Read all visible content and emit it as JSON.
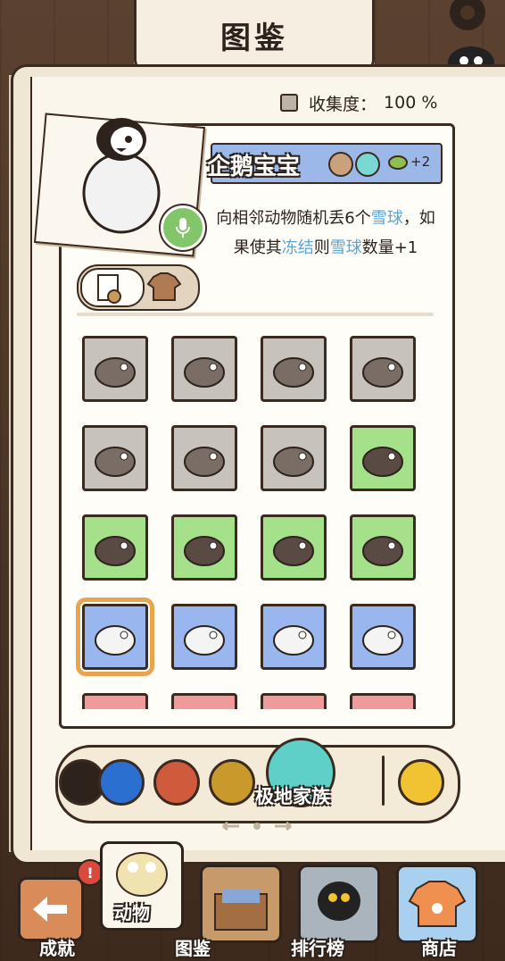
{
  "header": {
    "title": "图鉴"
  },
  "collection": {
    "label": "收集度：",
    "value": "100 %"
  },
  "animal": {
    "name": "企鹅宝宝",
    "cost_text": "+2",
    "desc_parts": [
      "向相邻动物随机丢6个",
      "雪球",
      "，如果使其",
      "冻结",
      "则",
      "雪球",
      "数量+1"
    ]
  },
  "family": {
    "selected_label": "极地家族"
  },
  "nav": {
    "achievements": "成就",
    "atlas": "图鉴",
    "animals": "动物",
    "ranking": "排行榜",
    "shop": "商店",
    "badge": "!"
  },
  "tiles": [
    {
      "name": "walrus-brown",
      "color": "gray"
    },
    {
      "name": "swallow",
      "color": "gray"
    },
    {
      "name": "puffin-dark",
      "color": "gray"
    },
    {
      "name": "otter",
      "color": "gray"
    },
    {
      "name": "walrus",
      "color": "gray"
    },
    {
      "name": "seal",
      "color": "gray"
    },
    {
      "name": "black-caterpillar",
      "color": "gray"
    },
    {
      "name": "horse",
      "color": "green"
    },
    {
      "name": "puffin",
      "color": "green"
    },
    {
      "name": "hamster",
      "color": "green"
    },
    {
      "name": "snake",
      "color": "green"
    },
    {
      "name": "ant",
      "color": "green"
    },
    {
      "name": "baby-penguin",
      "color": "blue",
      "selected": true
    },
    {
      "name": "snowy-owl",
      "color": "blue"
    },
    {
      "name": "arctic-hare",
      "color": "blue"
    },
    {
      "name": "fly",
      "color": "blue"
    },
    {
      "name": "red-1",
      "color": "red"
    },
    {
      "name": "red-2",
      "color": "red"
    },
    {
      "name": "red-3",
      "color": "red"
    },
    {
      "name": "red-4",
      "color": "red"
    }
  ],
  "colors": {
    "accent": "#5aa6d8",
    "selected_outline": "#e6a54e"
  }
}
